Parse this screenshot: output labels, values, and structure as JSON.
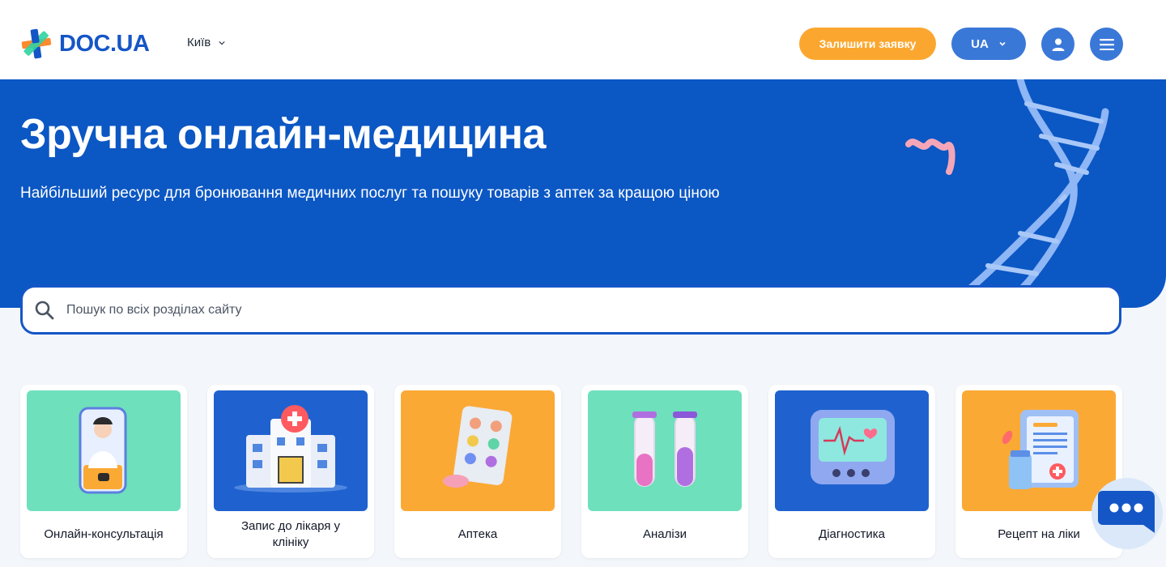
{
  "header": {
    "logo_text": "DOC.UA",
    "city": "Київ",
    "request_button": "Залишити заявку",
    "language": "UA"
  },
  "hero": {
    "title": "Зручна онлайн-медицина",
    "subtitle": "Найбільший ресурс для бронювання медичних послуг та пошуку товарів з аптек за кращою ціною"
  },
  "search": {
    "placeholder": "Пошук по всіх розділах сайту"
  },
  "categories": [
    {
      "label": "Онлайн-консультація",
      "icon": "doctor-phone-icon",
      "color": "#6ee0bc"
    },
    {
      "label": "Запис до лікаря у клініку",
      "icon": "hospital-icon",
      "color": "#1f62cf"
    },
    {
      "label": "Аптека",
      "icon": "pills-icon",
      "color": "#fba935"
    },
    {
      "label": "Аналізи",
      "icon": "test-tubes-icon",
      "color": "#6ee0bc"
    },
    {
      "label": "Діагностика",
      "icon": "monitor-icon",
      "color": "#1f62cf"
    },
    {
      "label": "Рецепт на ліки",
      "icon": "prescription-icon",
      "color": "#fba935"
    }
  ],
  "colors": {
    "brand_blue": "#0b57c4",
    "accent_orange": "#fba72f",
    "button_blue": "#3a78d8"
  }
}
